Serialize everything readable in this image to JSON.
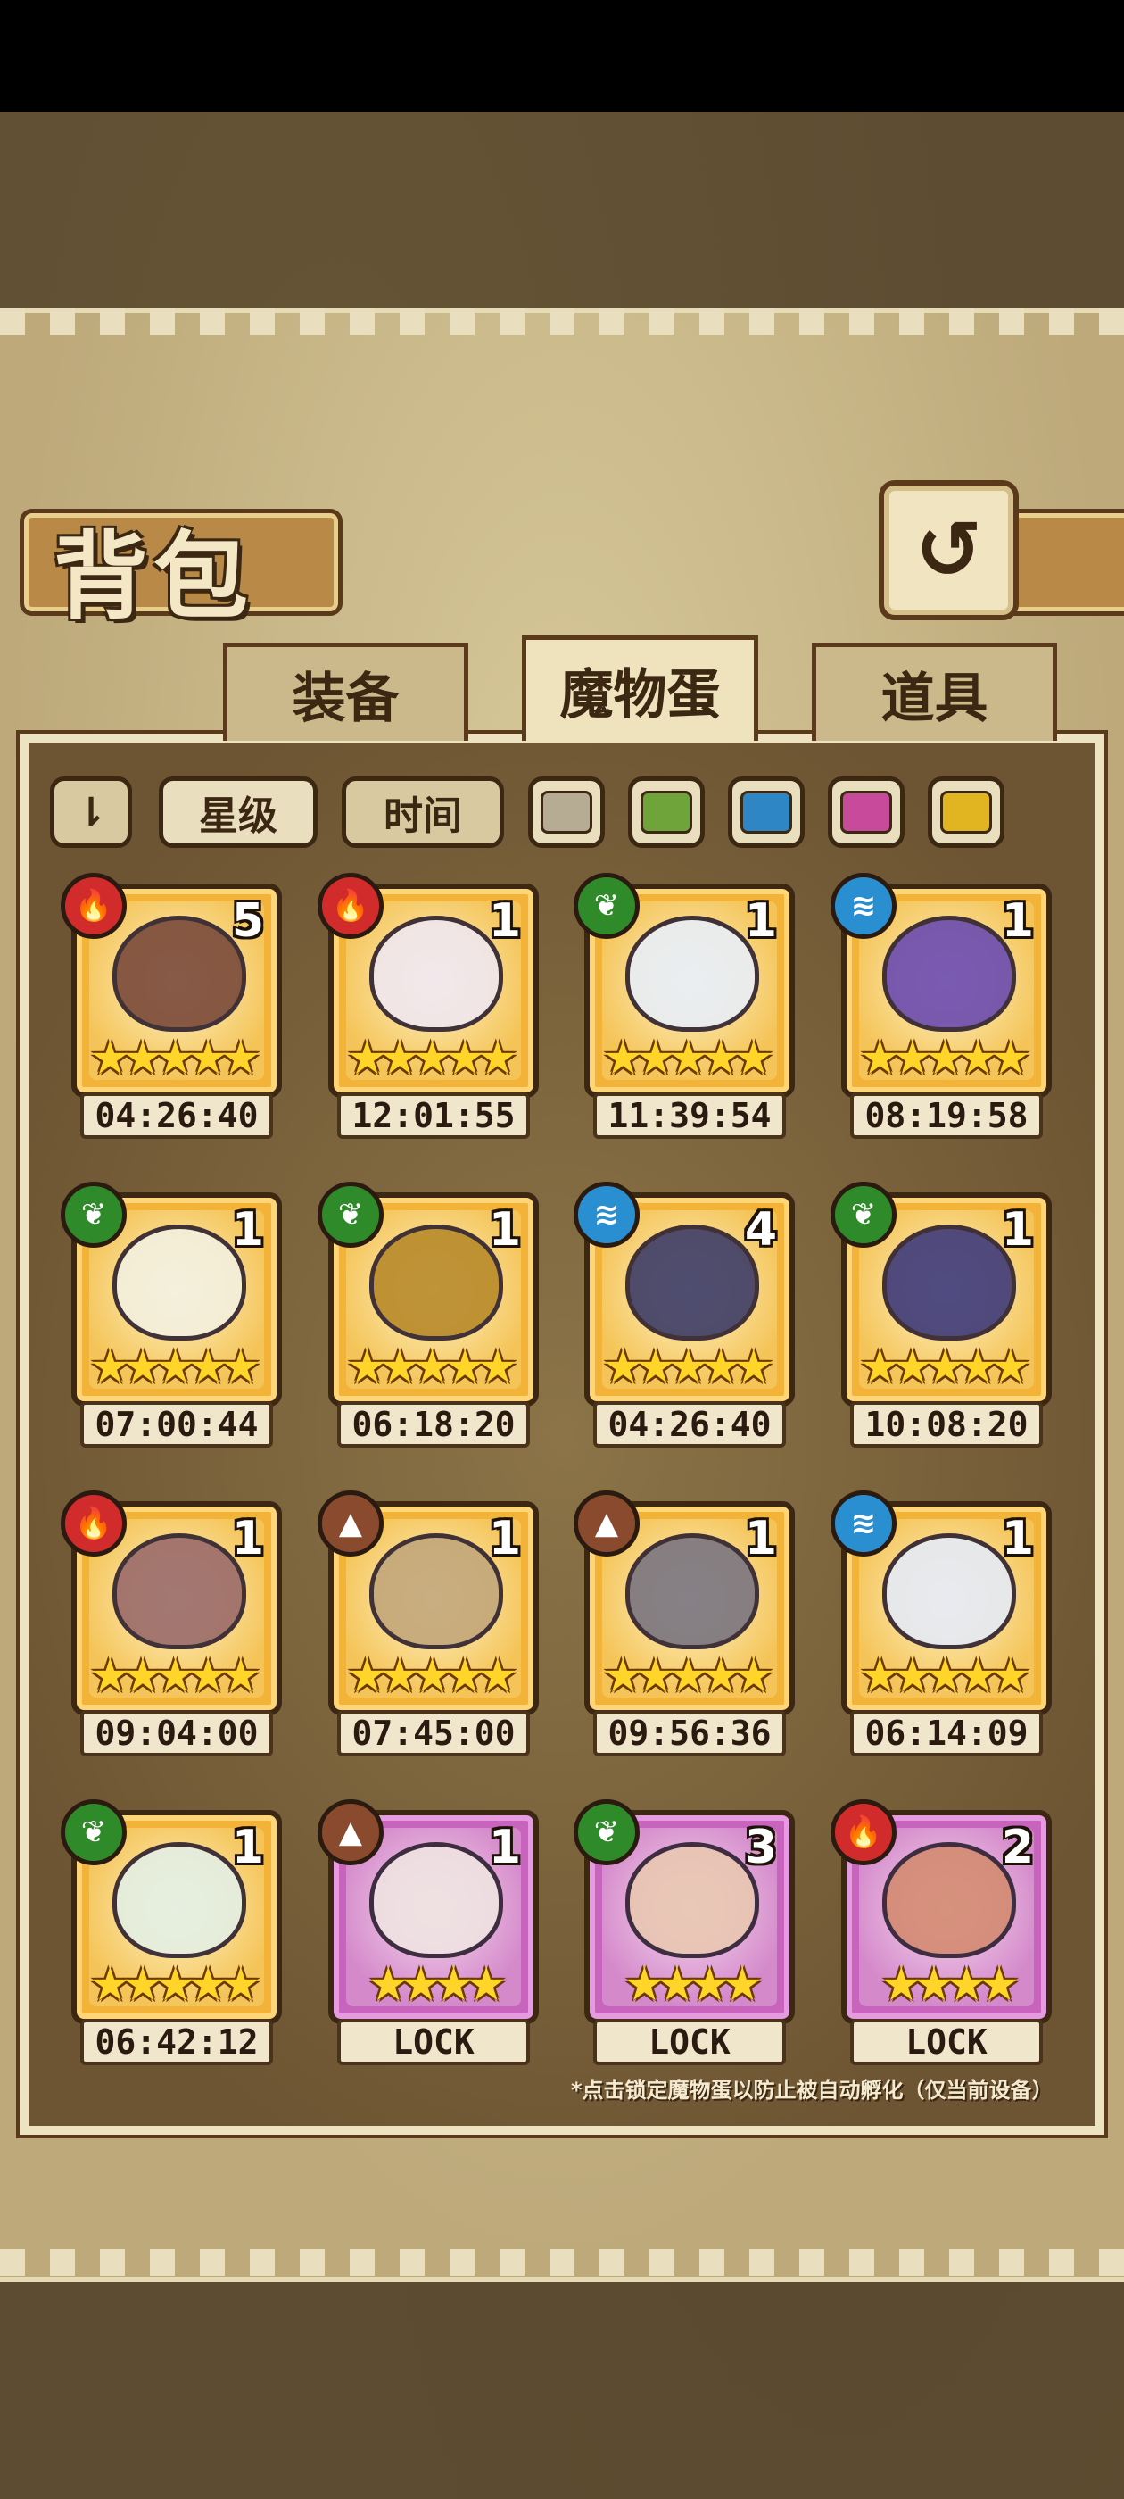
{
  "title": "背包",
  "tabs": [
    "装备",
    "魔物蛋",
    "道具"
  ],
  "active_tab": "魔物蛋",
  "back_icon": "↺",
  "sort": {
    "star_label": "星级",
    "time_label": "时间"
  },
  "color_filters": [
    {
      "name": "gray",
      "color": "#b6ac94"
    },
    {
      "name": "green",
      "color": "#6fa43a"
    },
    {
      "name": "blue",
      "color": "#2e86c4"
    },
    {
      "name": "pink",
      "color": "#c84a9b"
    },
    {
      "name": "yellow",
      "color": "#e0b521"
    }
  ],
  "element_colors": {
    "fire": "#d22b2b",
    "leaf": "#2f8a2a",
    "water": "#2a8fd0",
    "earth": "#8a4a2e"
  },
  "eggs": [
    {
      "element": "fire",
      "count": "5",
      "stars": "★★★★★",
      "time": "04:26:40",
      "frame": "gold",
      "art": "#7a4a3a"
    },
    {
      "element": "fire",
      "count": "1",
      "stars": "★★★★★",
      "time": "12:01:55",
      "frame": "gold",
      "art": "#f1e7ef"
    },
    {
      "element": "leaf",
      "count": "1",
      "stars": "★★★★★",
      "time": "11:39:54",
      "frame": "gold",
      "art": "#e9eef6"
    },
    {
      "element": "water",
      "count": "1",
      "stars": "★★★★★",
      "time": "08:19:58",
      "frame": "gold",
      "art": "#6b4bb0"
    },
    {
      "element": "leaf",
      "count": "1",
      "stars": "★★★★★",
      "time": "07:00:44",
      "frame": "gold",
      "art": "#f4f0de"
    },
    {
      "element": "leaf",
      "count": "1",
      "stars": "★★★★★",
      "time": "06:18:20",
      "frame": "gold",
      "art": "#b88a2a"
    },
    {
      "element": "water",
      "count": "4",
      "stars": "★★★★★",
      "time": "04:26:40",
      "frame": "gold",
      "art": "#3d3c67"
    },
    {
      "element": "leaf",
      "count": "1",
      "stars": "★★★★★",
      "time": "10:08:20",
      "frame": "gold",
      "art": "#3e3a7a"
    },
    {
      "element": "fire",
      "count": "1",
      "stars": "★★★★★",
      "time": "09:04:00",
      "frame": "gold",
      "art": "#9a6b6a"
    },
    {
      "element": "earth",
      "count": "1",
      "stars": "★★★★★",
      "time": "07:45:00",
      "frame": "gold",
      "art": "#c3a77a"
    },
    {
      "element": "earth",
      "count": "1",
      "stars": "★★★★★",
      "time": "09:56:36",
      "frame": "gold",
      "art": "#7a7580"
    },
    {
      "element": "water",
      "count": "1",
      "stars": "★★★★★",
      "time": "06:14:09",
      "frame": "gold",
      "art": "#e6eaf4"
    },
    {
      "element": "leaf",
      "count": "1",
      "stars": "★★★★★",
      "time": "06:42:12",
      "frame": "gold",
      "art": "#e4efe3"
    },
    {
      "element": "earth",
      "count": "1",
      "stars": "★★★★",
      "time": "LOCK",
      "frame": "purple",
      "art": "#efe3e2"
    },
    {
      "element": "leaf",
      "count": "3",
      "stars": "★★★★",
      "time": "LOCK",
      "frame": "purple",
      "art": "#e9c7b2"
    },
    {
      "element": "fire",
      "count": "2",
      "stars": "★★★★",
      "time": "LOCK",
      "frame": "purple",
      "art": "#d48b72"
    }
  ],
  "footer_note": "*点击锁定魔物蛋以防止被自动孵化（仅当前设备）"
}
